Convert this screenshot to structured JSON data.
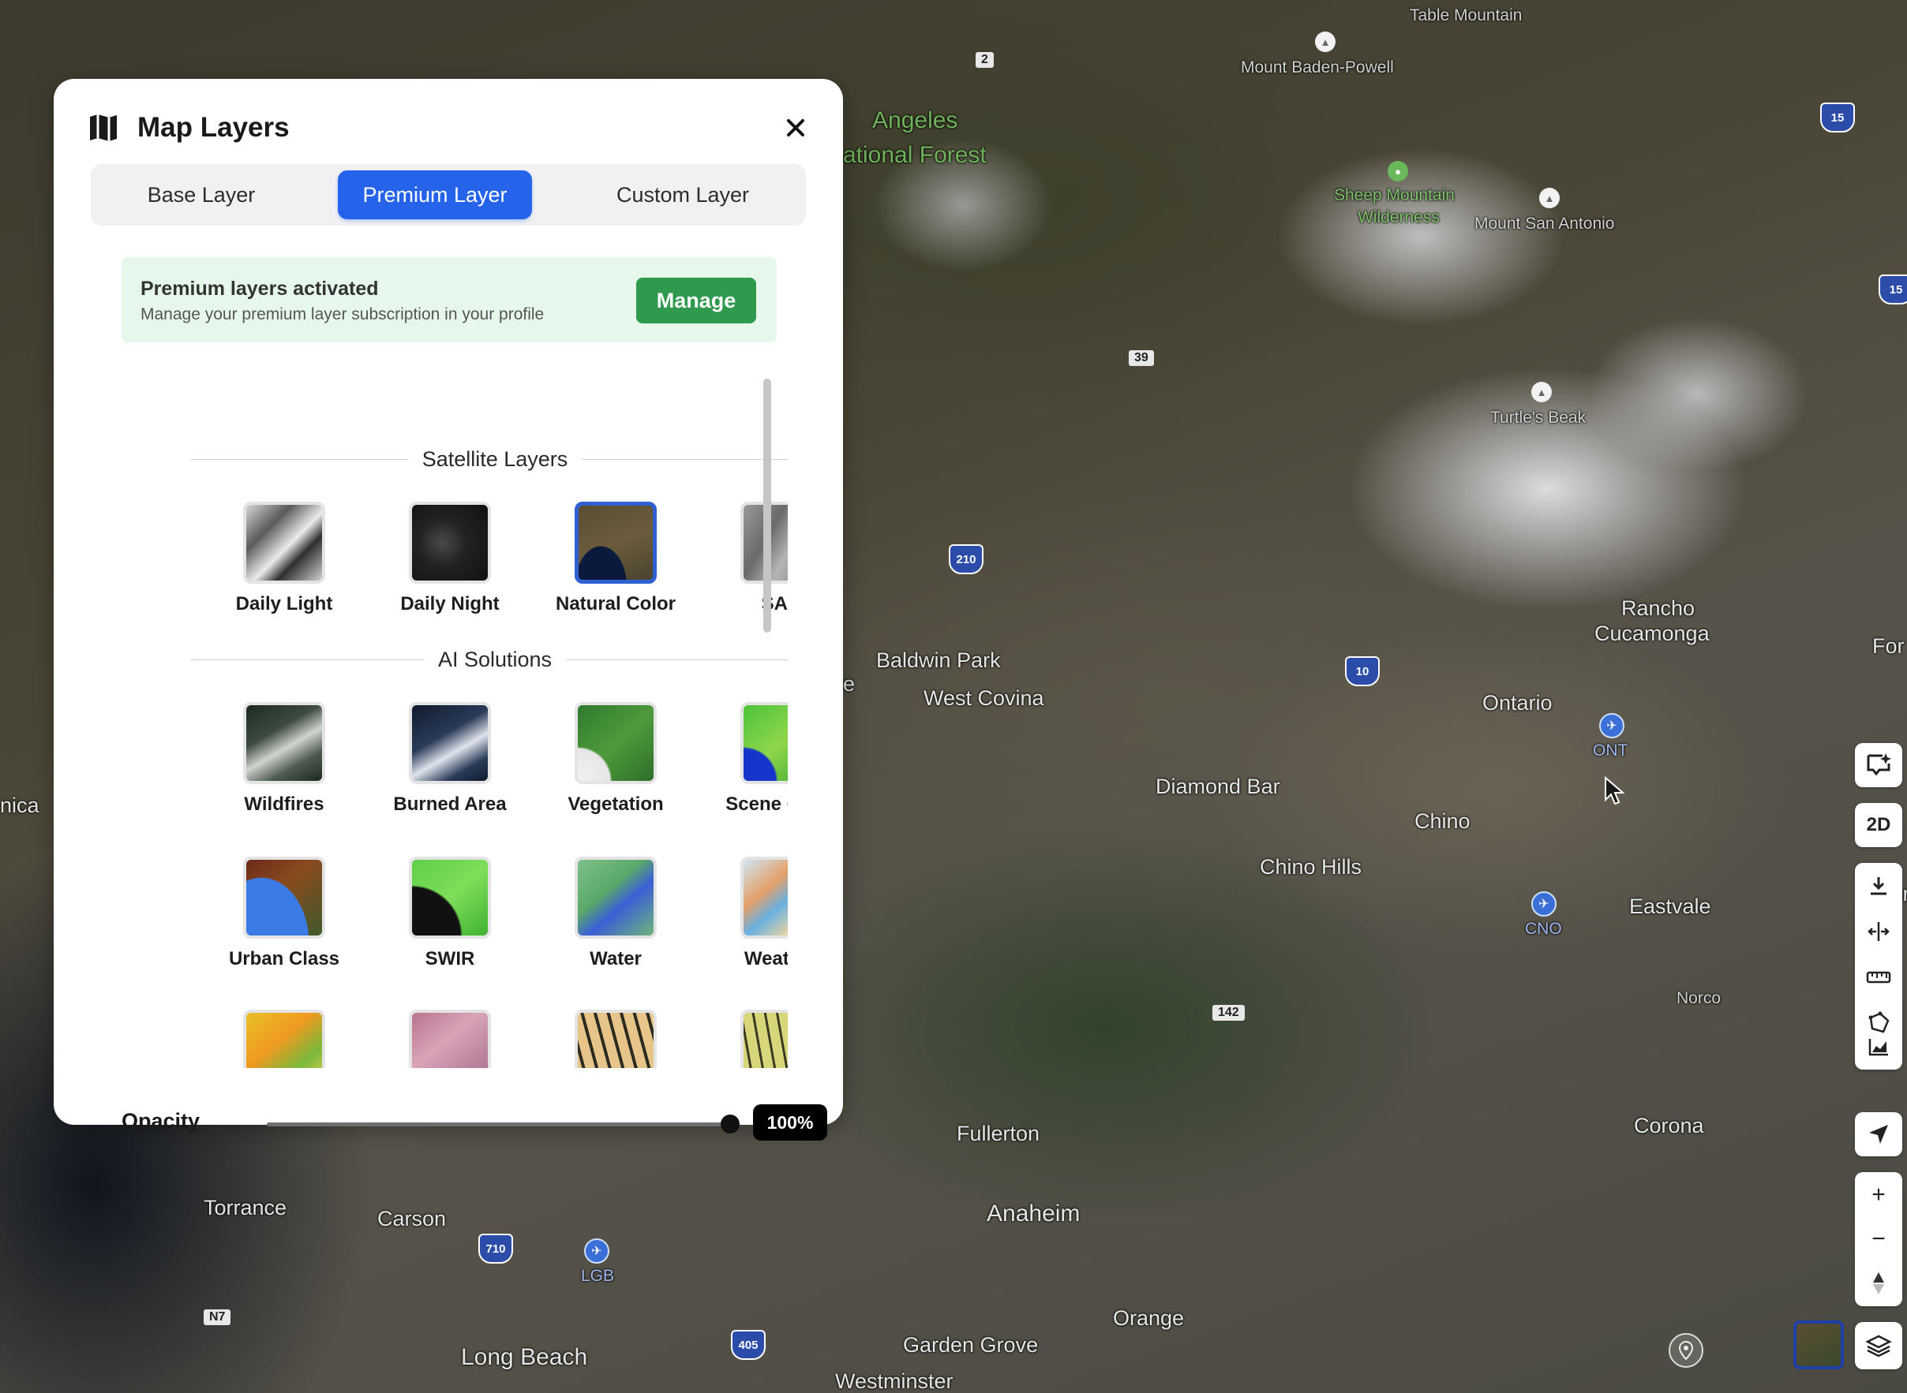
{
  "panel": {
    "title": "Map Layers",
    "tabs": [
      {
        "label": "Base Layer",
        "active": false
      },
      {
        "label": "Premium Layer",
        "active": true
      },
      {
        "label": "Custom Layer",
        "active": false
      }
    ],
    "notice": {
      "title": "Premium layers activated",
      "description": "Manage your premium layer subscription in your profile",
      "button": "Manage"
    },
    "sections": [
      {
        "title": "Satellite Layers",
        "layers": [
          {
            "label": "Daily Light",
            "icon": "daily-light-thumb"
          },
          {
            "label": "Daily Night",
            "icon": "daily-night-thumb"
          },
          {
            "label": "Natural Color",
            "icon": "natural-color-thumb",
            "selected": true
          },
          {
            "label": "SAR",
            "icon": "sar-thumb"
          }
        ]
      },
      {
        "title": "AI Solutions",
        "layers": [
          {
            "label": "Wildfires"
          },
          {
            "label": "Burned Area"
          },
          {
            "label": "Vegetation"
          },
          {
            "label": "Scene Class"
          },
          {
            "label": "Urban Class"
          },
          {
            "label": "SWIR"
          },
          {
            "label": "Water"
          },
          {
            "label": "Weather"
          }
        ]
      }
    ],
    "opacity": {
      "label": "Opacity",
      "value": "100%",
      "fraction": 1.0
    }
  },
  "map": {
    "labels": {
      "angeles": "Angeles",
      "national_forest": "ational Forest",
      "mount_baden_powell": "Mount Baden-Powell",
      "table_mountain": "Table Mountain",
      "sheep_mountain": "Sheep Mountain",
      "wilderness": "Wilderness",
      "mount_san_antonio": "Mount San Antonio",
      "turtles_beak": "Turtle's Beak",
      "baldwin_park": "Baldwin Park",
      "west_covina": "West Covina",
      "rancho": "Rancho",
      "cucamonga": "Cucamonga",
      "ontario": "Ontario",
      "ont": "ONT",
      "diamond_bar": "Diamond Bar",
      "chino": "Chino",
      "chino_hills": "Chino Hills",
      "eastvale": "Eastvale",
      "cno": "CNO",
      "norco": "Norco",
      "corona": "Corona",
      "fullerton": "Fullerton",
      "anaheim": "Anaheim",
      "torrance": "Torrance",
      "carson": "Carson",
      "lgb": "LGB",
      "orange": "Orange",
      "garden_grove": "Garden Grove",
      "long_beach": "Long Beach",
      "westminster": "Westminster",
      "nica": "nica",
      "jur": "Jur",
      "for": "For",
      "e": "e"
    },
    "routes": [
      "2",
      "39",
      "142",
      "N7"
    ],
    "interstates": [
      "15",
      "15",
      "210",
      "10",
      "710",
      "405"
    ]
  },
  "toolbar": {
    "view_mode": "2D",
    "icons": [
      "ai-sparkle-icon",
      "download-icon",
      "split-icon",
      "ruler-icon",
      "polygon-icon",
      "chart-icon",
      "locate-icon",
      "zoom-in-icon",
      "zoom-out-icon",
      "compass-icon",
      "layers-icon",
      "pin-icon"
    ]
  },
  "colors": {
    "accent": "#2563eb",
    "success": "#2f9a4e",
    "notice_bg": "#e6f7ec"
  }
}
